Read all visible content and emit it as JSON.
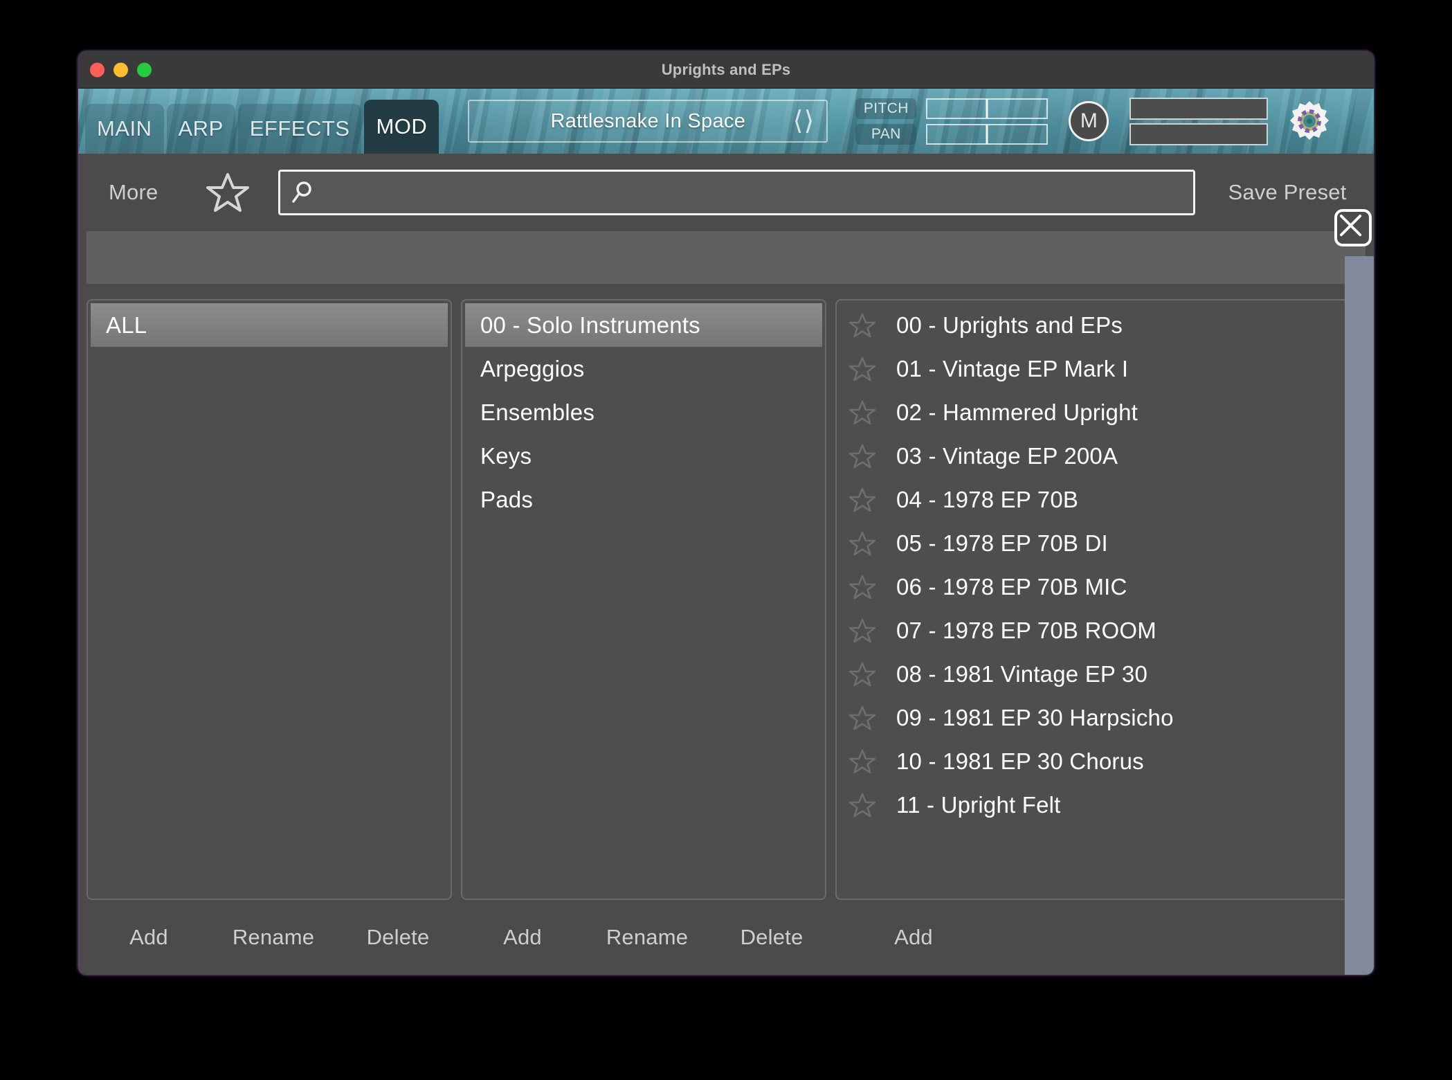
{
  "window": {
    "title": "Uprights and EPs",
    "traffic_lights": [
      "close",
      "minimize",
      "maximize"
    ]
  },
  "header": {
    "tabs": [
      {
        "label": "MAIN",
        "active": false
      },
      {
        "label": "ARP",
        "active": false
      },
      {
        "label": "EFFECTS",
        "active": false
      },
      {
        "label": "MOD",
        "active": true
      }
    ],
    "preset_display": {
      "name": "Rattlesnake In Space",
      "prev_icon": "chevron-left-icon",
      "next_icon": "chevron-right-icon"
    },
    "controls": [
      {
        "label": "PITCH",
        "value_position": "center"
      },
      {
        "label": "PAN",
        "value_position": "center"
      }
    ],
    "midi_button": "M",
    "meters": 2,
    "settings_icon": "gear-icon",
    "accent_color": "#4e98aa",
    "active_tab_color": "#233c44"
  },
  "browser": {
    "more_label": "More",
    "favorite_icon": "star-icon",
    "search": {
      "icon": "search-icon",
      "value": "",
      "placeholder": ""
    },
    "save_preset_label": "Save Preset",
    "close_icon": "close-icon",
    "banks": {
      "items": [
        {
          "label": "ALL",
          "selected": true
        }
      ],
      "actions": [
        "Add",
        "Rename",
        "Delete"
      ]
    },
    "categories": {
      "items": [
        {
          "label": "00 - Solo Instruments",
          "selected": true
        },
        {
          "label": "Arpeggios",
          "selected": false
        },
        {
          "label": "Ensembles",
          "selected": false
        },
        {
          "label": "Keys",
          "selected": false
        },
        {
          "label": "Pads",
          "selected": false
        }
      ],
      "actions": [
        "Add",
        "Rename",
        "Delete"
      ]
    },
    "presets": {
      "items": [
        {
          "label": "00 - Uprights and EPs",
          "favorite": false
        },
        {
          "label": "01 - Vintage EP Mark I",
          "favorite": false
        },
        {
          "label": "02 - Hammered Upright",
          "favorite": false
        },
        {
          "label": "03 - Vintage EP 200A",
          "favorite": false
        },
        {
          "label": "04 - 1978 EP 70B",
          "favorite": false
        },
        {
          "label": "05 - 1978 EP 70B DI",
          "favorite": false
        },
        {
          "label": "06 - 1978 EP 70B MIC",
          "favorite": false
        },
        {
          "label": "07 - 1978 EP 70B ROOM",
          "favorite": false
        },
        {
          "label": "08 - 1981 Vintage EP 30",
          "favorite": false
        },
        {
          "label": "09 - 1981 EP 30 Harpsicho",
          "favorite": false
        },
        {
          "label": "10 - 1981 EP 30 Chorus",
          "favorite": false
        },
        {
          "label": "11 - Upright Felt",
          "favorite": false
        }
      ],
      "actions": [
        "Add"
      ]
    }
  }
}
